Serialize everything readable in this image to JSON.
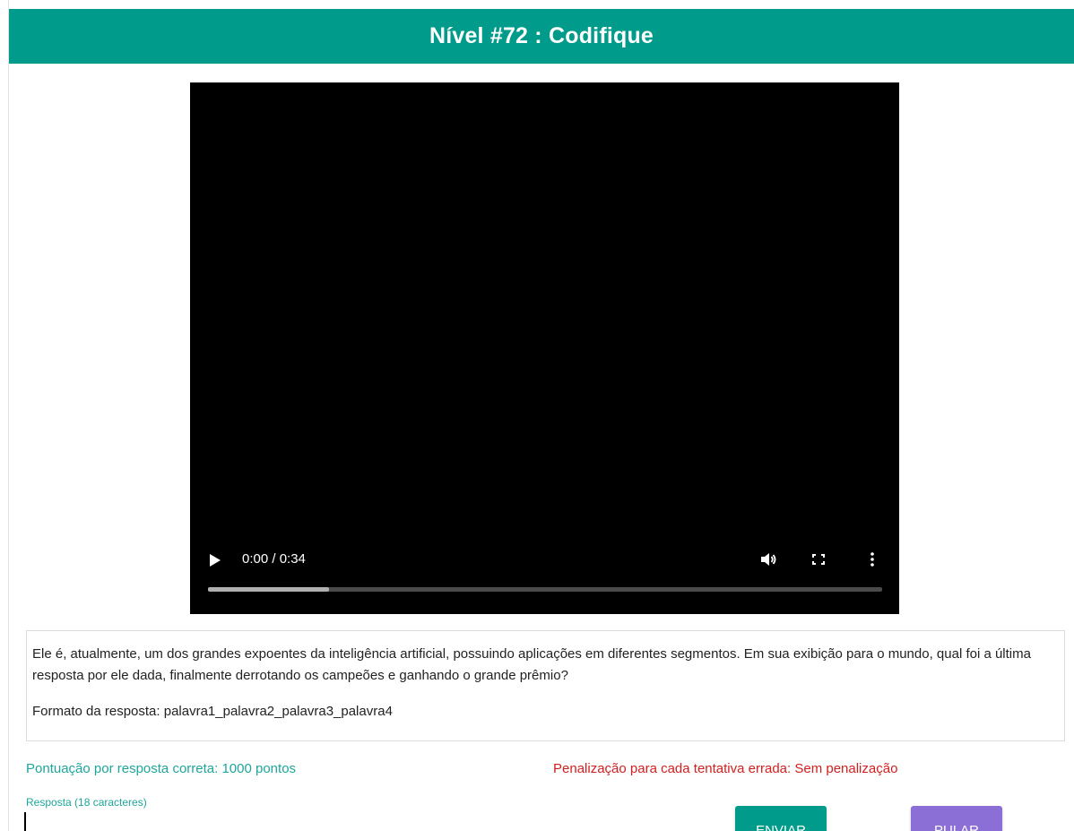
{
  "header": {
    "title": "Nível #72 : Codifique",
    "color": "#009b8a"
  },
  "video": {
    "time": "0:00 / 0:34",
    "progress_fraction": 0.18,
    "icons": [
      "play-icon",
      "volume-icon",
      "fullscreen-icon",
      "more-icon"
    ]
  },
  "question": {
    "text": "Ele é, atualmente, um dos grandes expoentes da inteligência artificial, possuindo aplicações em diferentes segmentos. Em sua exibição para o mundo, qual foi a última resposta por ele dada, finalmente derrotando os campeões e ganhando o grande prêmio?",
    "format": "Formato da resposta: palavra1_palavra2_palavra3_palavra4"
  },
  "scoring": {
    "points": "Pontuação por resposta correta: 1000 pontos",
    "penalty": "Penalização para cada tentativa errada: Sem penalização"
  },
  "answer": {
    "label": "Resposta (18 caracteres)",
    "value": ""
  },
  "buttons": {
    "send": "ENVIAR",
    "skip": "PULAR"
  }
}
